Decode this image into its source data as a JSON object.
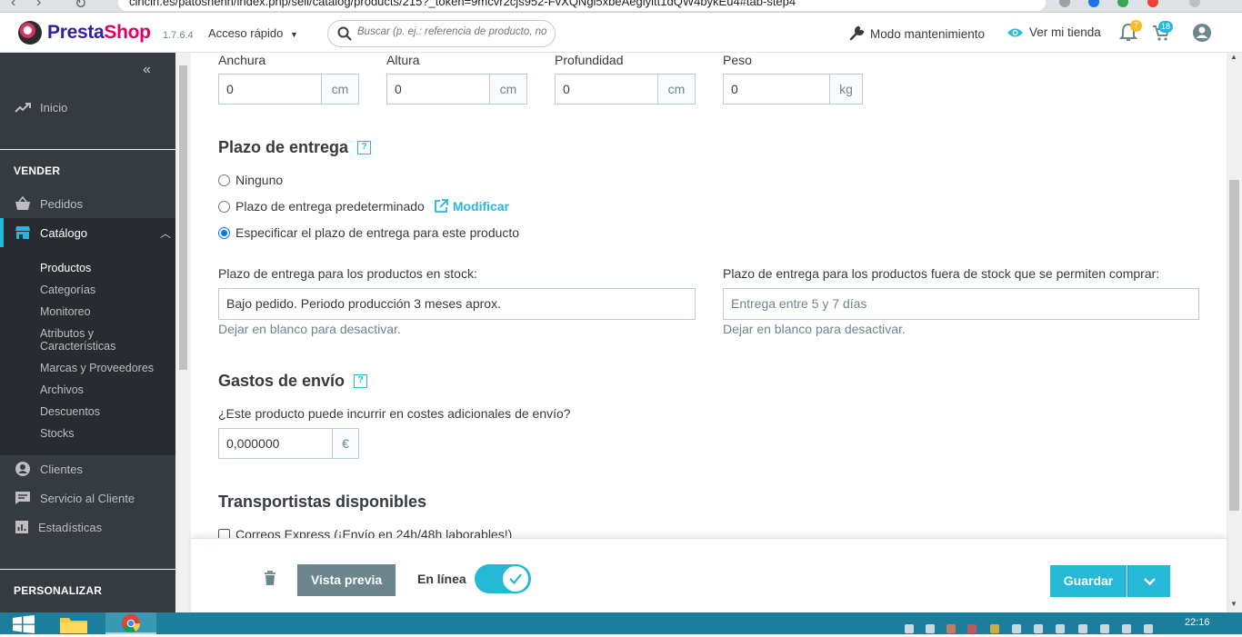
{
  "browser": {
    "url": "cincin.es/patoshenn/index.php/sell/catalog/products/215?_token=9mcvr2cjs952-FvXQNgl5xbeAeglyitt1dQW4bykEu4#tab-step4"
  },
  "header": {
    "brand_a": "Presta",
    "brand_b": "Shop",
    "version": "1.7.6.4",
    "quick_access": "Acceso rápido",
    "search_placeholder": "Buscar (p. ej.: referencia de producto, no",
    "maintenance": "Modo mantenimiento",
    "view_store": "Ver mi tienda",
    "notif_badge": "7",
    "orders_badge": "18"
  },
  "sidebar": {
    "home": "Inicio",
    "sell_heading": "VENDER",
    "orders": "Pedidos",
    "catalog": "Catálogo",
    "catalog_items": [
      "Productos",
      "Categorías",
      "Monitoreo",
      "Atributos y",
      "Características",
      "Marcas y Proveedores",
      "Archivos",
      "Descuentos",
      "Stocks"
    ],
    "customers": "Clientes",
    "customer_service": "Servicio al Cliente",
    "stats": "Estadísticas",
    "customize_heading": "PERSONALIZAR"
  },
  "dimensions": {
    "width_label": "Anchura",
    "width_value": "0",
    "width_unit": "cm",
    "height_label": "Altura",
    "height_value": "0",
    "height_unit": "cm",
    "depth_label": "Profundidad",
    "depth_value": "0",
    "depth_unit": "cm",
    "weight_label": "Peso",
    "weight_value": "0",
    "weight_unit": "kg"
  },
  "delivery": {
    "title": "Plazo de entrega",
    "option_none": "Ninguno",
    "option_default": "Plazo de entrega predeterminado",
    "modify": "Modificar",
    "option_specific": "Especificar el plazo de entrega para este producto",
    "in_stock_label": "Plazo de entrega para los productos en stock:",
    "in_stock_value": "Bajo pedido. Periodo producción 3 meses aprox.",
    "out_stock_label": "Plazo de entrega para los productos fuera de stock que se permiten comprar:",
    "out_stock_placeholder": "Entrega entre 5 y 7 días",
    "hint": "Dejar en blanco para desactivar."
  },
  "shipping": {
    "title": "Gastos de envío",
    "question": "¿Este producto puede incurrir en costes adicionales de envío?",
    "value": "0,000000",
    "currency": "€"
  },
  "carriers": {
    "title": "Transportistas disponibles",
    "first": "Correos Express (¡Envío en 24h/48h laborables!)"
  },
  "footer": {
    "preview": "Vista previa",
    "online": "En línea",
    "save": "Guardar",
    "online_on": true
  },
  "taskbar": {
    "clock": "22:16"
  },
  "colors": {
    "accent": "#25b9d7",
    "sidebar": "#363a41",
    "brand_purple": "#34209e",
    "brand_pink": "#df0067"
  }
}
